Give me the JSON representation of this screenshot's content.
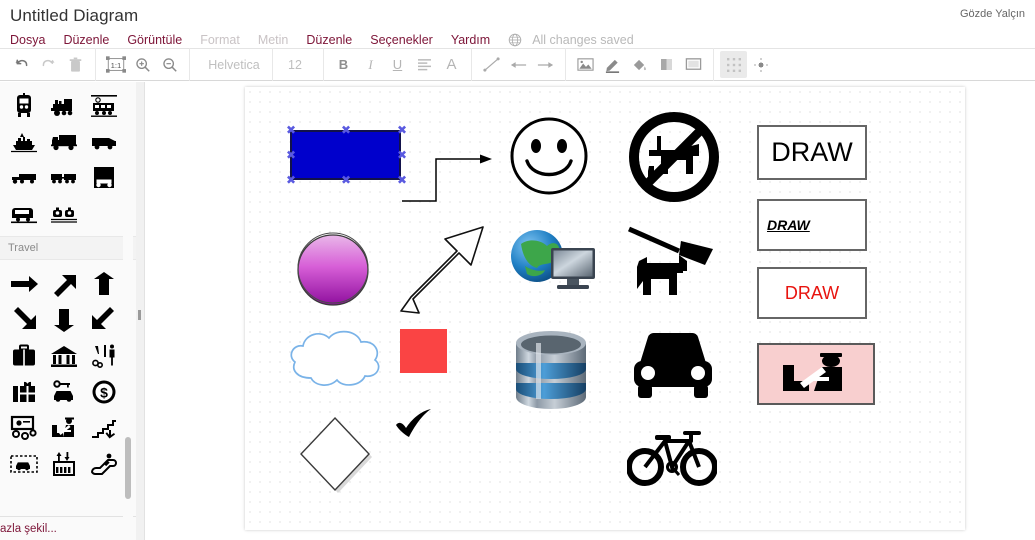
{
  "header": {
    "doc_title": "Untitled Diagram",
    "user_name": "Gözde Yalçın",
    "save_status": "All changes saved",
    "globe_icon": "globe-icon",
    "menu": [
      {
        "label": "Dosya",
        "enabled": true
      },
      {
        "label": "Düzenle",
        "enabled": true
      },
      {
        "label": "Görüntüle",
        "enabled": true
      },
      {
        "label": "Format",
        "enabled": false
      },
      {
        "label": "Metin",
        "enabled": false
      },
      {
        "label": "Düzenle",
        "enabled": true
      },
      {
        "label": "Seçenekler",
        "enabled": true
      },
      {
        "label": "Yardım",
        "enabled": true
      }
    ]
  },
  "toolbar": {
    "undo": "undo-icon",
    "redo": "redo-icon",
    "delete": "trash-icon",
    "fit_page": "1:1",
    "zoom_in": "zoom-in-icon",
    "zoom_out": "zoom-out-icon",
    "font_name": "Helvetica",
    "font_size": "12",
    "bold": "B",
    "italic": "I",
    "underline": "U",
    "align": "align-icon",
    "font_color": "A",
    "line": "line-icon",
    "arrow_left": "←",
    "arrow_right": "→",
    "image": "image-icon",
    "line_color": "pen-icon",
    "fill_color": "fill-bucket-icon",
    "shadow": "shadow-icon",
    "shape_style": "shape-icon",
    "grid": "grid-icon",
    "waypoints": "waypoints-icon",
    "grid_active": true
  },
  "left_panel": {
    "section_label": "Travel",
    "more_shapes": "azla şekil...",
    "transport_shapes": [
      "train-front-icon",
      "steam-locomotive-icon",
      "train-station-icon",
      "boat-icon",
      "delivery-truck-icon",
      "van-icon",
      "tow-truck-icon",
      "bus-trailer-icon",
      "truck-front-icon",
      "tram-icon",
      "cable-car-icon"
    ],
    "travel_shapes": [
      "arrow-right-icon",
      "arrow-up-right-icon",
      "arrow-up-icon",
      "arrow-down-right-icon",
      "arrow-down-icon",
      "arrow-down-left-icon",
      "suitcase-icon",
      "bank-icon",
      "restroom-icon",
      "gift-shop-icon",
      "car-rental-icon",
      "dollar-coin-icon",
      "currency-exchange-icon",
      "customs-icon",
      "stairs-down-icon",
      "car-park-icon",
      "elevator-icon",
      "escalator-icon"
    ]
  },
  "canvas": {
    "shapes": [
      {
        "name": "blue-rectangle",
        "label": "",
        "selected": true
      },
      {
        "name": "purple-sphere",
        "label": ""
      },
      {
        "name": "cloud",
        "label": ""
      },
      {
        "name": "diamond",
        "label": ""
      },
      {
        "name": "elbow-connector-arrow",
        "label": ""
      },
      {
        "name": "block-arrow",
        "label": ""
      },
      {
        "name": "red-square",
        "label": ""
      },
      {
        "name": "checkmark",
        "label": ""
      },
      {
        "name": "smiley-face",
        "label": ""
      },
      {
        "name": "internet-globe-monitor",
        "label": ""
      },
      {
        "name": "database-cylinder",
        "label": ""
      },
      {
        "name": "no-dogs-sign",
        "label": ""
      },
      {
        "name": "dog-on-leash",
        "label": ""
      },
      {
        "name": "car-front",
        "label": ""
      },
      {
        "name": "bicycle",
        "label": ""
      },
      {
        "name": "draw-box-large",
        "label": "DRAW"
      },
      {
        "name": "draw-box-italic",
        "label": "DRAW"
      },
      {
        "name": "draw-box-red",
        "label": "DRAW"
      },
      {
        "name": "pink-customs-box",
        "label": ""
      }
    ],
    "draw_label_1": "DRAW",
    "draw_label_2": "DRAW",
    "draw_label_3": "DRAW"
  },
  "colors": {
    "menu_accent": "#7d1538",
    "blue_rect_fill": "#0000cc",
    "red_square_fill": "#fa4444",
    "red_text": "#e8140f",
    "pink_box_fill": "#f8cfcf",
    "cloud_stroke": "#7ab3e8",
    "selection_handle": "#5a5ae0"
  }
}
